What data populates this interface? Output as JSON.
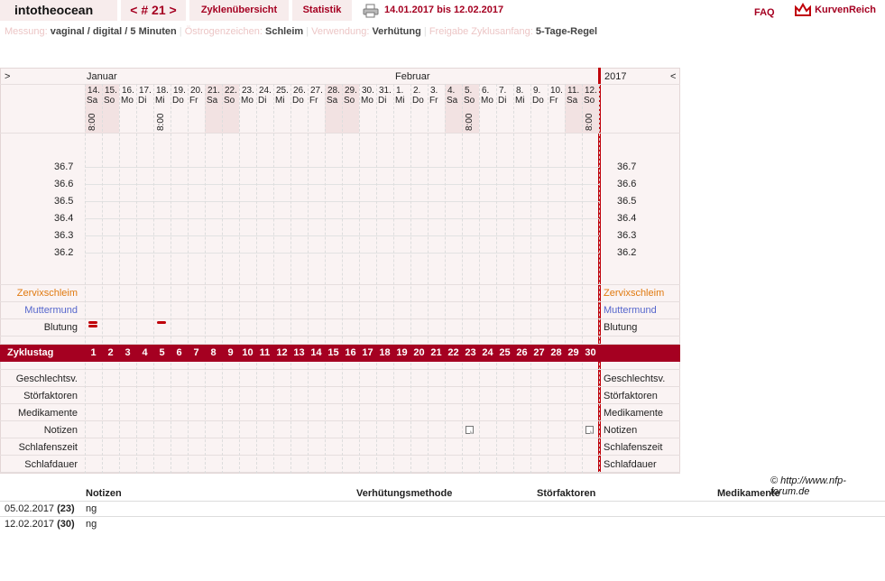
{
  "topbar": {
    "username": "intotheocean",
    "cycle_nav": "< # 21 >",
    "zyklen_label": "Zyklenübersicht",
    "statistik_label": "Statistik",
    "date_range": "14.01.2017 bis 12.02.2017",
    "faq_label": "FAQ",
    "logo_text": "KurvenReich"
  },
  "meta": {
    "messung_label": "Messung:",
    "messung_value": "vaginal / digital / 5 Minuten",
    "oestrogen_label": "Östrogenzeichen:",
    "oestrogen_value": "Schleim",
    "verwendung_label": "Verwendung:",
    "verwendung_value": "Verhütung",
    "freigabe_label": "Freigabe Zyklusanfang:",
    "freigabe_value": "5-Tage-Regel"
  },
  "chart": {
    "left_arrow": ">",
    "right_arrow": "<",
    "month_jan": "Januar",
    "month_feb": "Februar",
    "year": "2017",
    "days": [
      {
        "d": "14.",
        "w": "Sa",
        "t": "8:00",
        "we": true
      },
      {
        "d": "15.",
        "w": "So",
        "t": "",
        "we": true
      },
      {
        "d": "16.",
        "w": "Mo",
        "t": "",
        "we": false
      },
      {
        "d": "17.",
        "w": "Di",
        "t": "",
        "we": false
      },
      {
        "d": "18.",
        "w": "Mi",
        "t": "8:00",
        "we": false
      },
      {
        "d": "19.",
        "w": "Do",
        "t": "",
        "we": false
      },
      {
        "d": "20.",
        "w": "Fr",
        "t": "",
        "we": false
      },
      {
        "d": "21.",
        "w": "Sa",
        "t": "",
        "we": true
      },
      {
        "d": "22.",
        "w": "So",
        "t": "",
        "we": true
      },
      {
        "d": "23.",
        "w": "Mo",
        "t": "",
        "we": false
      },
      {
        "d": "24.",
        "w": "Di",
        "t": "",
        "we": false
      },
      {
        "d": "25.",
        "w": "Mi",
        "t": "",
        "we": false
      },
      {
        "d": "26.",
        "w": "Do",
        "t": "",
        "we": false
      },
      {
        "d": "27.",
        "w": "Fr",
        "t": "",
        "we": false
      },
      {
        "d": "28.",
        "w": "Sa",
        "t": "",
        "we": true
      },
      {
        "d": "29.",
        "w": "So",
        "t": "",
        "we": true
      },
      {
        "d": "30.",
        "w": "Mo",
        "t": "",
        "we": false
      },
      {
        "d": "31.",
        "w": "Di",
        "t": "",
        "we": false
      },
      {
        "d": "1.",
        "w": "Mi",
        "t": "",
        "we": false
      },
      {
        "d": "2.",
        "w": "Do",
        "t": "",
        "we": false
      },
      {
        "d": "3.",
        "w": "Fr",
        "t": "",
        "we": false
      },
      {
        "d": "4.",
        "w": "Sa",
        "t": "",
        "we": true
      },
      {
        "d": "5.",
        "w": "So",
        "t": "8:00",
        "we": true
      },
      {
        "d": "6.",
        "w": "Mo",
        "t": "",
        "we": false
      },
      {
        "d": "7.",
        "w": "Di",
        "t": "",
        "we": false
      },
      {
        "d": "8.",
        "w": "Mi",
        "t": "",
        "we": false
      },
      {
        "d": "9.",
        "w": "Do",
        "t": "",
        "we": false
      },
      {
        "d": "10.",
        "w": "Fr",
        "t": "",
        "we": false
      },
      {
        "d": "11.",
        "w": "Sa",
        "t": "",
        "we": true
      },
      {
        "d": "12.",
        "w": "So",
        "t": "8:00",
        "we": true
      }
    ],
    "temps": [
      "36.7",
      "36.6",
      "36.5",
      "36.4",
      "36.3",
      "36.2"
    ],
    "zervix_label": "Zervixschleim",
    "mutter_label": "Muttermund",
    "blutung_label": "Blutung",
    "bleeding_days": [
      1,
      1,
      5
    ],
    "zyklustag_label": "Zyklustag",
    "bottom_rows": [
      "Geschlechtsv.",
      "Störfaktoren",
      "Medikamente",
      "Notizen",
      "Schlafenszeit",
      "Schlafdauer"
    ],
    "note_days": [
      23,
      30
    ],
    "zervix_color": "#e07a10",
    "mutter_color": "#5566cc",
    "accent": "#a50021"
  },
  "source": "© http://www.nfp-forum.de",
  "notes_table": {
    "headers": [
      "",
      "Notizen",
      "Verhütungsmethode",
      "Störfaktoren",
      "Medikamente"
    ],
    "rows": [
      {
        "date": "05.02.2017",
        "day": "(23)",
        "note": "ng"
      },
      {
        "date": "12.02.2017",
        "day": "(30)",
        "note": "ng"
      }
    ]
  }
}
